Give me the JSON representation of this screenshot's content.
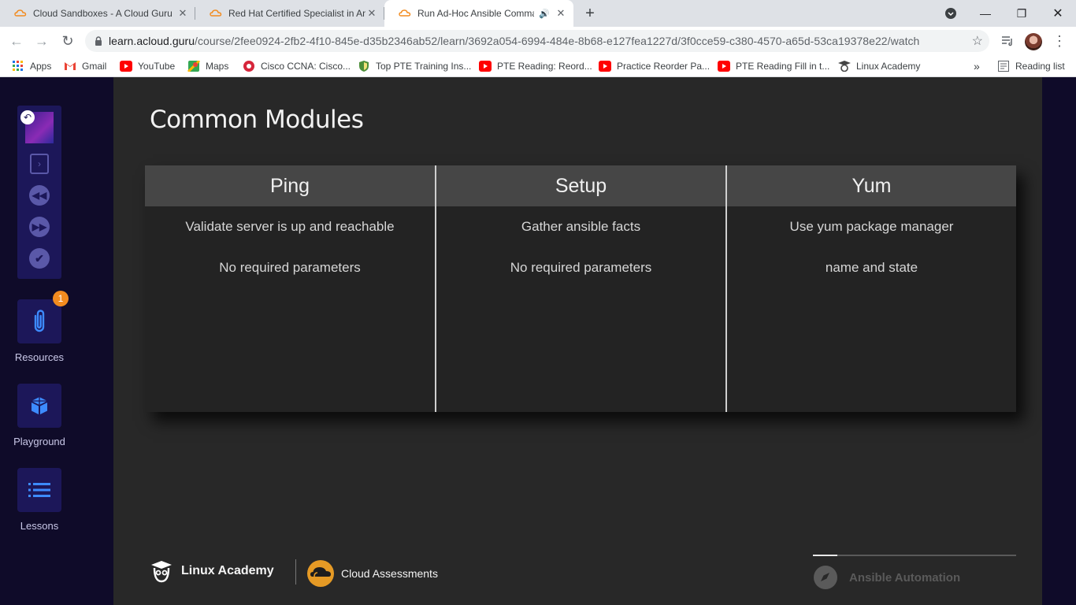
{
  "browser": {
    "tabs": [
      {
        "title": "Cloud Sandboxes - A Cloud Guru",
        "active": false
      },
      {
        "title": "Red Hat Certified Specialist in An",
        "active": false
      },
      {
        "title": "Run Ad-Hoc Ansible Comma",
        "active": true
      }
    ],
    "url_host": "learn.acloud.guru",
    "url_path": "/course/2fee0924-2fb2-4f10-845e-d35b2346ab52/learn/3692a054-6994-484e-8b68-e127fea1227d/3f0cce59-c380-4570-a65d-53ca19378e22/watch",
    "bookmarks": [
      {
        "label": "Apps",
        "icon": "apps-grid-icon"
      },
      {
        "label": "Gmail",
        "icon": "gmail-icon"
      },
      {
        "label": "YouTube",
        "icon": "youtube-icon"
      },
      {
        "label": "Maps",
        "icon": "maps-icon"
      },
      {
        "label": "Cisco CCNA: Cisco...",
        "icon": "cisco-icon"
      },
      {
        "label": "Top PTE Training Ins...",
        "icon": "shield-icon"
      },
      {
        "label": "PTE Reading: Reord...",
        "icon": "youtube-icon"
      },
      {
        "label": "Practice Reorder Pa...",
        "icon": "youtube-icon"
      },
      {
        "label": "PTE Reading Fill in t...",
        "icon": "youtube-icon"
      },
      {
        "label": "Linux Academy",
        "icon": "linux-academy-icon"
      }
    ],
    "overflow": "»",
    "reading_list": "Reading list"
  },
  "sidebar": {
    "resources_label": "Resources",
    "resources_badge": "1",
    "playground_label": "Playground",
    "lessons_label": "Lessons"
  },
  "slide": {
    "title": "Common Modules",
    "columns": [
      {
        "header": "Ping",
        "lines": [
          "Validate server is up and reachable",
          "No required parameters"
        ]
      },
      {
        "header": "Setup",
        "lines": [
          "Gather ansible facts",
          "No required parameters"
        ]
      },
      {
        "header": "Yum",
        "lines": [
          "Use yum package manager",
          "name and state"
        ]
      }
    ],
    "footer": {
      "brand1": "Linux Academy",
      "brand2": "Cloud Assessments",
      "section": "Ansible Automation",
      "progress": 0.12
    }
  },
  "colors": {
    "sidebar_bg": "#0f0b29",
    "tile_bg": "#1c1759",
    "accent_blue": "#3d8bff",
    "badge": "#f28b1f"
  }
}
